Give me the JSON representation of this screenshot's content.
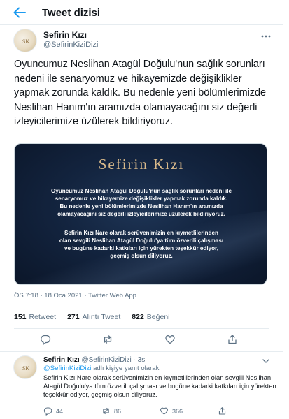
{
  "header": {
    "title": "Tweet dizisi",
    "back_icon": "arrow-left-icon"
  },
  "tweet": {
    "author_name": "Sefirin Kızı",
    "author_handle": "@SefirinKiziDizi",
    "text": "Oyuncumuz Neslihan Atagül Doğulu'nun sağlık sorunları nedeni ile senaryomuz ve hikayemizde değişiklikler yapmak zorunda kaldık. Bu nedenle yeni bölümlerimizde Neslihan Hanım'ın aramızda olamayacağını siz değerli izleyicilerimize üzülerek bildiriyoruz.",
    "media": {
      "logo_text": "Sefirin Kızı",
      "paragraph1": "Oyuncumuz Neslihan Atagül Doğulu'nun sağlık sorunları nedeni ile senaryomuz ve hikayemize değişiklikler yapmak zorunda kaldık. Bu nedenle yeni bölümlerimizde Neslihan Hanım'ın aramızda olamayacağını siz değerli izleyicilerimize üzülerek bildiriyoruz.",
      "paragraph2": "Sefirin Kızı Nare olarak serüvenimizin en kıymetlilerinden olan sevgili Neslihan Atagül Doğulu'ya tüm özverili çalışması ve bugüne kadarki katkıları için yürekten teşekkür ediyor, geçmiş olsun diliyoruz."
    },
    "timestamp": "ÖS 7:18 · 18 Oca 2021 · Twitter Web App",
    "stats": {
      "retweets_count": "151",
      "retweets_label": "Retweet",
      "quotes_count": "271",
      "quotes_label": "Alıntı Tweet",
      "likes_count": "822",
      "likes_label": "Beğeni"
    }
  },
  "reply": {
    "author_name": "Sefirin Kızı",
    "author_handle": "@SefirinKiziDizi",
    "time": "· 3s",
    "reply_to_mention": "@SefirinKiziDizi",
    "reply_to_suffix": "adlı kişiye yanıt olarak",
    "text": "Sefirin Kızı Nare olarak serüvenimizin en kıymetlilerinden olan sevgili Neslihan Atagül Doğulu'ya tüm özverili çalışması ve bugüne kadarki katkıları için yürekten teşekkür ediyor, geçmiş olsun diliyoruz.",
    "reply_count": "44",
    "retweet_count": "86",
    "like_count": "366"
  },
  "colors": {
    "accent": "#1d9bf0",
    "muted": "#5b7083",
    "divider": "#e6ecf0",
    "media_bg": "#13243f",
    "logo_gold": "#d8b98a"
  }
}
